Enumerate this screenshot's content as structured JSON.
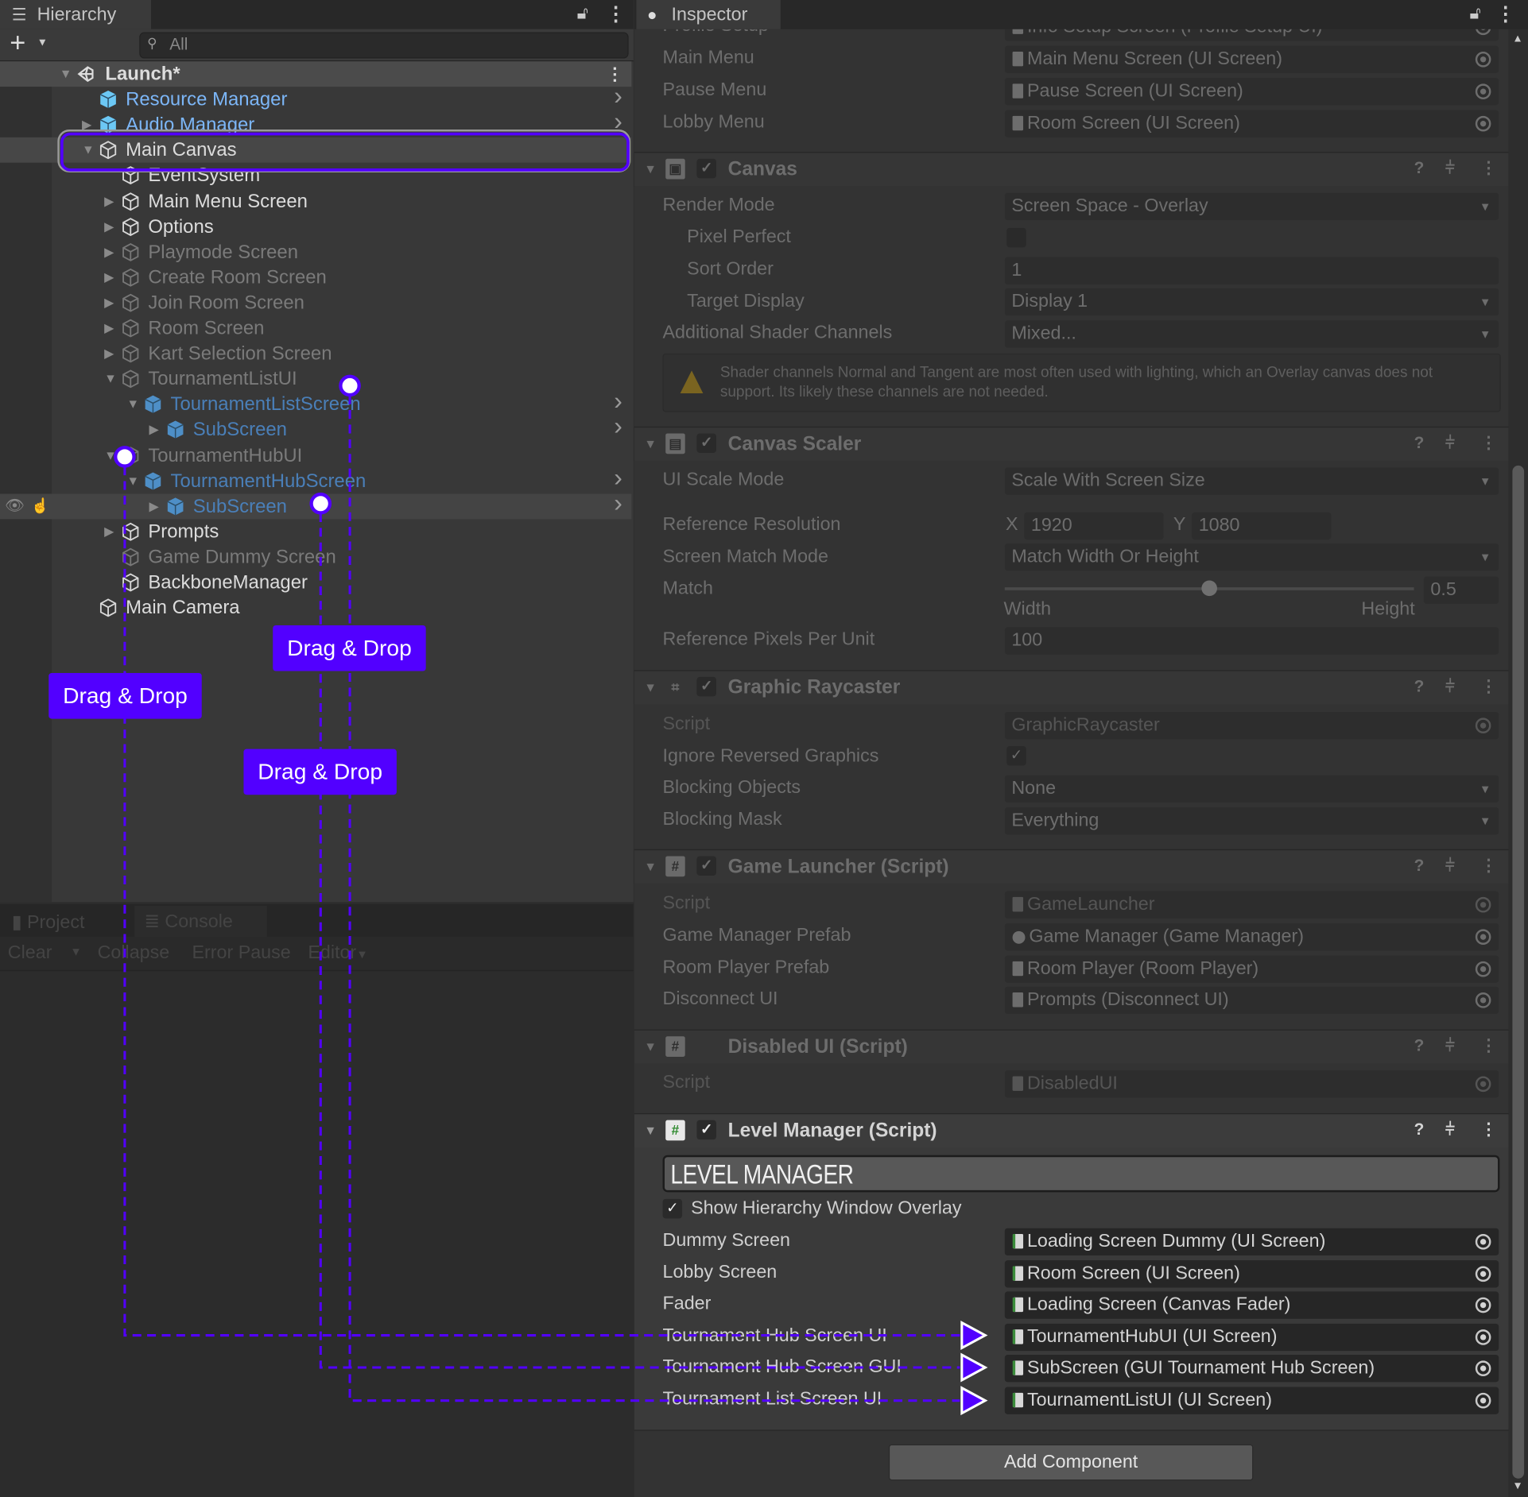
{
  "hierarchy": {
    "tab": "Hierarchy",
    "search_placeholder": "All",
    "rows": [
      {
        "text": "Launch*",
        "depth": 0,
        "arrow": "down",
        "kind": "scene",
        "dim": false,
        "chevron": false
      },
      {
        "text": "Resource Manager",
        "depth": 1,
        "arrow": "",
        "kind": "prefab",
        "dim": false,
        "chevron": true
      },
      {
        "text": "Audio Manager",
        "depth": 1,
        "arrow": "right",
        "kind": "prefab",
        "dim": false,
        "chevron": true
      },
      {
        "text": "Main Canvas",
        "depth": 1,
        "arrow": "down",
        "kind": "object",
        "dim": false,
        "chevron": false,
        "highlight": true
      },
      {
        "text": "EventSystem",
        "depth": 2,
        "arrow": "",
        "kind": "object",
        "dim": false,
        "chevron": false
      },
      {
        "text": "Main Menu Screen",
        "depth": 2,
        "arrow": "right",
        "kind": "object",
        "dim": false,
        "chevron": false
      },
      {
        "text": "Options",
        "depth": 2,
        "arrow": "right",
        "kind": "object",
        "dim": false,
        "chevron": false
      },
      {
        "text": "Playmode Screen",
        "depth": 2,
        "arrow": "right",
        "kind": "object",
        "dim": true,
        "chevron": false
      },
      {
        "text": "Create Room Screen",
        "depth": 2,
        "arrow": "right",
        "kind": "object",
        "dim": true,
        "chevron": false
      },
      {
        "text": "Join Room Screen",
        "depth": 2,
        "arrow": "right",
        "kind": "object",
        "dim": true,
        "chevron": false
      },
      {
        "text": "Room Screen",
        "depth": 2,
        "arrow": "right",
        "kind": "object",
        "dim": true,
        "chevron": false
      },
      {
        "text": "Kart Selection Screen",
        "depth": 2,
        "arrow": "right",
        "kind": "object",
        "dim": true,
        "chevron": false
      },
      {
        "text": "TournamentListUI",
        "depth": 2,
        "arrow": "down",
        "kind": "object",
        "dim": true,
        "chevron": false
      },
      {
        "text": "TournamentListScreen",
        "depth": 3,
        "arrow": "down",
        "kind": "prefab",
        "dim": true,
        "chevron": true
      },
      {
        "text": "SubScreen",
        "depth": 4,
        "arrow": "right",
        "kind": "prefab",
        "dim": true,
        "chevron": true
      },
      {
        "text": "TournamentHubUI",
        "depth": 2,
        "arrow": "down",
        "kind": "object",
        "dim": true,
        "chevron": false
      },
      {
        "text": "TournamentHubScreen",
        "depth": 3,
        "arrow": "down",
        "kind": "prefab",
        "dim": true,
        "chevron": true
      },
      {
        "text": "SubScreen",
        "depth": 4,
        "arrow": "right",
        "kind": "prefab",
        "dim": true,
        "chevron": true,
        "hovered": true
      },
      {
        "text": "Prompts",
        "depth": 2,
        "arrow": "right",
        "kind": "object",
        "dim": false,
        "chevron": false
      },
      {
        "text": "Game Dummy Screen",
        "depth": 2,
        "arrow": "",
        "kind": "object",
        "dim": true,
        "chevron": false
      },
      {
        "text": "BackboneManager",
        "depth": 2,
        "arrow": "",
        "kind": "object",
        "dim": false,
        "chevron": false
      },
      {
        "text": "Main Camera",
        "depth": 1,
        "arrow": "",
        "kind": "object",
        "dim": false,
        "chevron": false
      }
    ]
  },
  "console": {
    "tabs": [
      "Project",
      "Console"
    ],
    "toolbar": [
      "Clear",
      "Collapse",
      "Error Pause",
      "Editor"
    ]
  },
  "inspector": {
    "tab": "Inspector",
    "top_rows": [
      {
        "label": "Profile Setup",
        "value": "Info Setup Screen (Profile Setup UI)"
      },
      {
        "label": "Main Menu",
        "value": "Main Menu Screen (UI Screen)"
      },
      {
        "label": "Pause Menu",
        "value": "Pause Screen (UI Screen)"
      },
      {
        "label": "Lobby Menu",
        "value": "Room Screen (UI Screen)"
      }
    ],
    "canvas": {
      "title": "Canvas",
      "render_mode": {
        "label": "Render Mode",
        "value": "Screen Space - Overlay"
      },
      "pixel_perfect": {
        "label": "Pixel Perfect",
        "checked": false
      },
      "sort_order": {
        "label": "Sort Order",
        "value": "1"
      },
      "target_display": {
        "label": "Target Display",
        "value": "Display 1"
      },
      "shader_channels": {
        "label": "Additional Shader Channels",
        "value": "Mixed..."
      },
      "warning": "Shader channels Normal and Tangent are most often used with lighting, which an Overlay canvas does not support. Its likely these channels are not needed."
    },
    "canvas_scaler": {
      "title": "Canvas Scaler",
      "ui_scale_mode": {
        "label": "UI Scale Mode",
        "value": "Scale With Screen Size"
      },
      "reference_resolution": {
        "label": "Reference Resolution",
        "x_label": "X",
        "x": "1920",
        "y_label": "Y",
        "y": "1080"
      },
      "screen_match_mode": {
        "label": "Screen Match Mode",
        "value": "Match Width Or Height"
      },
      "match": {
        "label": "Match",
        "value": "0.5",
        "slider": 0.5,
        "min_label": "Width",
        "max_label": "Height"
      },
      "pixels_per_unit": {
        "label": "Reference Pixels Per Unit",
        "value": "100"
      }
    },
    "graphic_raycaster": {
      "title": "Graphic Raycaster",
      "script": {
        "label": "Script",
        "value": "GraphicRaycaster"
      },
      "ignore_reversed": {
        "label": "Ignore Reversed Graphics",
        "checked": true
      },
      "blocking_objects": {
        "label": "Blocking Objects",
        "value": "None"
      },
      "blocking_mask": {
        "label": "Blocking Mask",
        "value": "Everything"
      }
    },
    "game_launcher": {
      "title": "Game Launcher (Script)",
      "rows": [
        {
          "label": "Script",
          "value": "GameLauncher"
        },
        {
          "label": "Game Manager Prefab",
          "value": "Game Manager (Game Manager)"
        },
        {
          "label": "Room Player Prefab",
          "value": "Room Player (Room Player)"
        },
        {
          "label": "Disconnect UI",
          "value": "Prompts (Disconnect UI)"
        }
      ]
    },
    "disabled_ui": {
      "title": "Disabled UI (Script)",
      "script": {
        "label": "Script",
        "value": "DisabledUI"
      }
    },
    "level_manager": {
      "title": "Level Manager (Script)",
      "banner": "LEVEL MANAGER",
      "overlay_toggle": {
        "label": "Show Hierarchy Window Overlay",
        "checked": true
      },
      "rows": [
        {
          "label": "Dummy Screen",
          "value": "Loading Screen Dummy (UI Screen)"
        },
        {
          "label": "Lobby Screen",
          "value": "Room Screen (UI Screen)"
        },
        {
          "label": "Fader",
          "value": "Loading Screen (Canvas Fader)"
        },
        {
          "label": "Tournament Hub Screen UI",
          "value": "TournamentHubUI (UI Screen)"
        },
        {
          "label": "Tournament Hub Screen GUI",
          "value": "SubScreen (GUI Tournament Hub Screen)"
        },
        {
          "label": "Tournament List Screen UI",
          "value": "TournamentListUI (UI Screen)"
        }
      ]
    },
    "add_component": "Add Component"
  },
  "annotations": {
    "drag_labels": [
      "Drag & Drop",
      "Drag & Drop",
      "Drag & Drop"
    ],
    "accent": "#5200ff"
  }
}
